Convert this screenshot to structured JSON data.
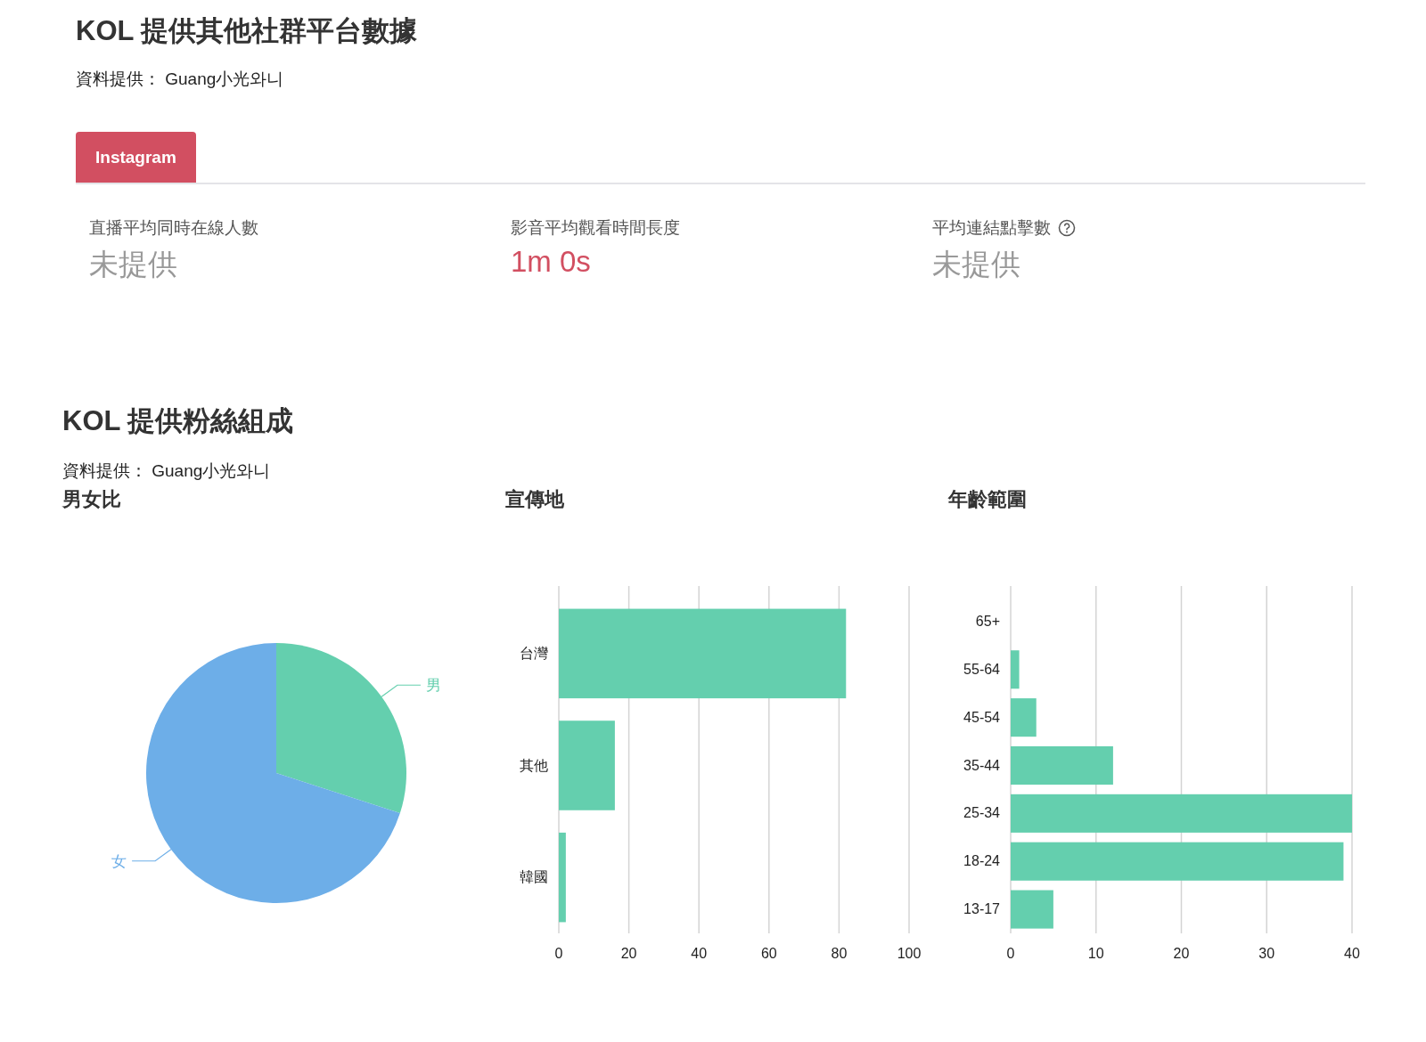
{
  "header": {
    "title": "KOL 提供其他社群平台數據",
    "source": "資料提供： Guang小光와니"
  },
  "tabs": [
    {
      "label": "Instagram",
      "selected": true
    }
  ],
  "metrics": [
    {
      "label": "直播平均同時在線人數",
      "value": "未提供",
      "provided": false,
      "help": false
    },
    {
      "label": "影音平均觀看時間長度",
      "value": "1m 0s",
      "provided": true,
      "help": false
    },
    {
      "label": "平均連結點擊數",
      "value": "未提供",
      "provided": false,
      "help": true
    }
  ],
  "fans": {
    "title": "KOL 提供粉絲組成",
    "source": "資料提供： Guang小光와니",
    "charts": [
      {
        "chart_data": {
          "type": "pie",
          "title": "男女比",
          "categories": [
            "男",
            "女"
          ],
          "colors": [
            "#64cfae",
            "#6daee8"
          ],
          "series": [
            {
              "values": [
                30,
                70
              ]
            }
          ]
        }
      },
      {
        "chart_data": {
          "type": "bar",
          "orientation": "horizontal",
          "title": "宣傳地",
          "categories": [
            "台灣",
            "其他",
            "韓國"
          ],
          "series": [
            {
              "color": "#64cfae",
              "values": [
                82,
                16,
                2
              ]
            }
          ],
          "xlim": [
            0,
            100
          ],
          "xticks": [
            0,
            20,
            40,
            60,
            80,
            100
          ],
          "grid": true
        }
      },
      {
        "chart_data": {
          "type": "bar",
          "orientation": "horizontal",
          "title": "年齡範圍",
          "categories": [
            "65+",
            "55-64",
            "45-54",
            "35-44",
            "25-34",
            "18-24",
            "13-17"
          ],
          "series": [
            {
              "color": "#64cfae",
              "values": [
                0,
                1,
                3,
                12,
                40,
                39,
                5
              ]
            }
          ],
          "xlim": [
            0,
            40
          ],
          "xticks": [
            0,
            10,
            20,
            30,
            40
          ],
          "grid": true
        }
      }
    ]
  }
}
